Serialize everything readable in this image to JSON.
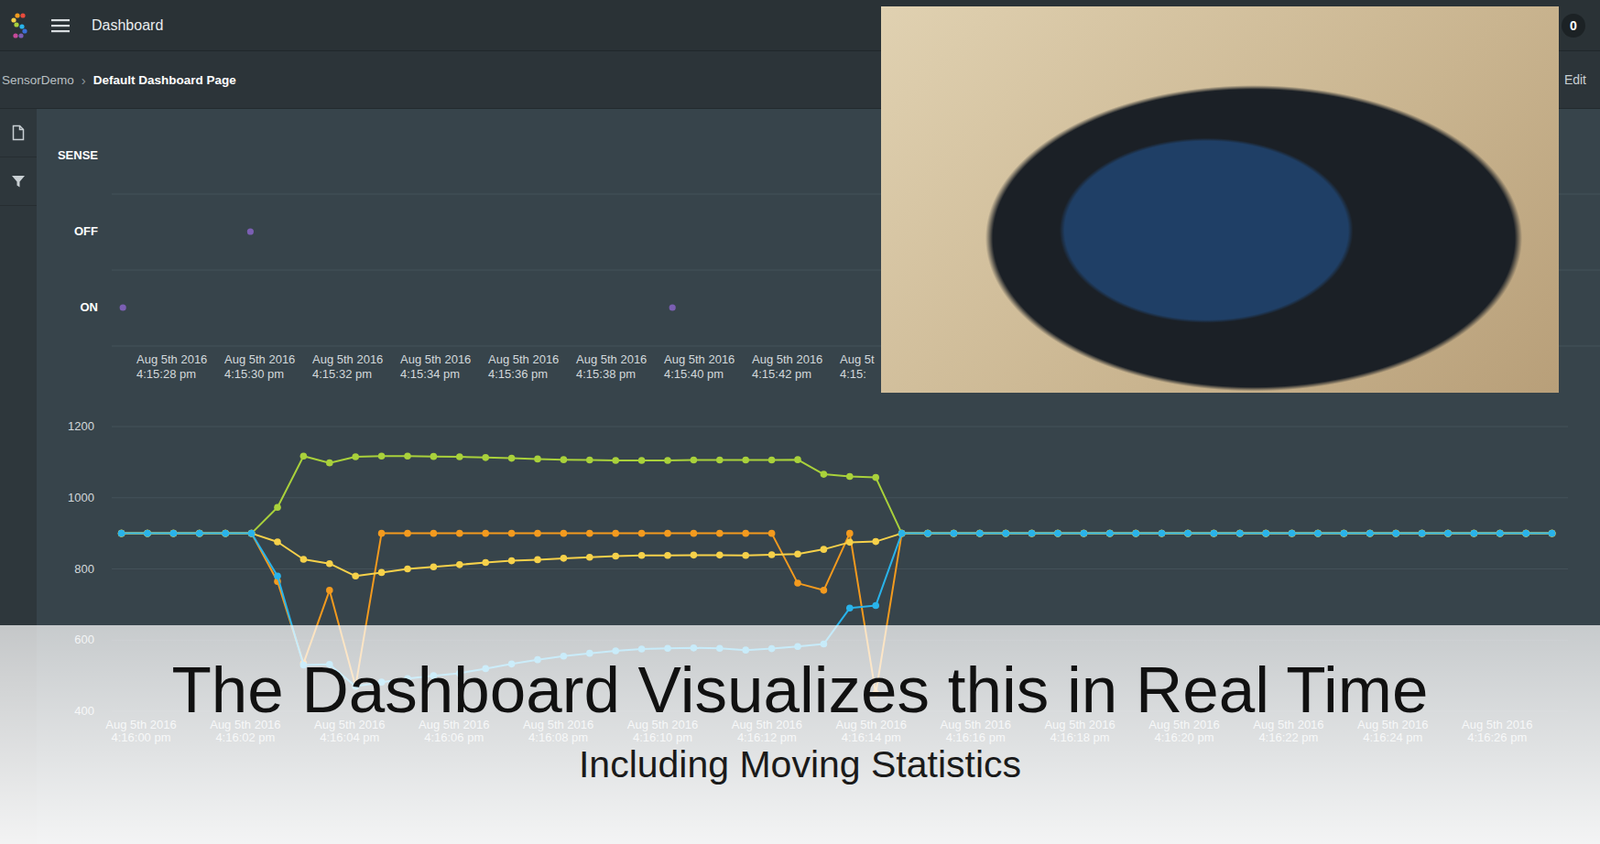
{
  "header": {
    "title": "Dashboard",
    "badge": "0"
  },
  "breadcrumb": {
    "items": [
      {
        "label": "SensorDemo",
        "current": false
      },
      {
        "label": "Default Dashboard Page",
        "current": true
      }
    ],
    "separator": "›",
    "action": "Edit"
  },
  "state_chart": {
    "categories": [
      "SENSE",
      "OFF",
      "ON"
    ],
    "ticks": [
      {
        "date": "Aug 5th 2016",
        "time": "4:15:28 pm"
      },
      {
        "date": "Aug 5th 2016",
        "time": "4:15:30 pm"
      },
      {
        "date": "Aug 5th 2016",
        "time": "4:15:32 pm"
      },
      {
        "date": "Aug 5th 2016",
        "time": "4:15:34 pm"
      },
      {
        "date": "Aug 5th 2016",
        "time": "4:15:36 pm"
      },
      {
        "date": "Aug 5th 2016",
        "time": "4:15:38 pm"
      },
      {
        "date": "Aug 5th 2016",
        "time": "4:15:40 pm"
      },
      {
        "date": "Aug 5th 2016",
        "time": "4:15:42 pm"
      },
      {
        "date": "Aug 5t",
        "time": "4:15:"
      }
    ],
    "points": [
      {
        "seconds_from_first_tick": -1.1,
        "state": "ON"
      },
      {
        "seconds_from_first_tick": 1.8,
        "state": "OFF"
      },
      {
        "seconds_from_first_tick": 11.4,
        "state": "ON"
      }
    ]
  },
  "value_chart": {
    "y_ticks": [
      "1200",
      "1000",
      "800",
      "600",
      "400"
    ],
    "x_ticks": [
      {
        "date": "Aug 5th 2016",
        "time": "4:16:00 pm"
      },
      {
        "date": "Aug 5th 2016",
        "time": "4:16:02 pm"
      },
      {
        "date": "Aug 5th 2016",
        "time": "4:16:04 pm"
      },
      {
        "date": "Aug 5th 2016",
        "time": "4:16:06 pm"
      },
      {
        "date": "Aug 5th 2016",
        "time": "4:16:08 pm"
      },
      {
        "date": "Aug 5th 2016",
        "time": "4:16:10 pm"
      },
      {
        "date": "Aug 5th 2016",
        "time": "4:16:12 pm"
      },
      {
        "date": "Aug 5th 2016",
        "time": "4:16:14 pm"
      },
      {
        "date": "Aug 5th 2016",
        "time": "4:16:16 pm"
      },
      {
        "date": "Aug 5th 2016",
        "time": "4:16:18 pm"
      },
      {
        "date": "Aug 5th 2016",
        "time": "4:16:20 pm"
      },
      {
        "date": "Aug 5th 2016",
        "time": "4:16:22 pm"
      },
      {
        "date": "Aug 5th 2016",
        "time": "4:16:24 pm"
      },
      {
        "date": "Aug 5th 2016",
        "time": "4:16:26 pm"
      }
    ],
    "series": [
      {
        "color": "#a9d13b",
        "values": [
          900,
          900,
          900,
          900,
          900,
          900,
          973,
          1117,
          1098,
          1115,
          1117,
          1117,
          1116,
          1115,
          1113,
          1111,
          1109,
          1107,
          1106,
          1105,
          1105,
          1105,
          1106,
          1106,
          1106,
          1106,
          1107,
          1066,
          1060,
          1057,
          900,
          900,
          900,
          900,
          900,
          900,
          900,
          900,
          900,
          900,
          900,
          900,
          900,
          900,
          900,
          900,
          900,
          900,
          900,
          900,
          900,
          900,
          900,
          900,
          900,
          900
        ]
      },
      {
        "color": "#f39a1e",
        "values": [
          900,
          900,
          900,
          900,
          900,
          900,
          765,
          535,
          740,
          470,
          900,
          900,
          900,
          900,
          900,
          900,
          900,
          900,
          900,
          900,
          900,
          900,
          900,
          900,
          900,
          900,
          760,
          740,
          900,
          450,
          900,
          900,
          900,
          900,
          900,
          900,
          900,
          900,
          900,
          900,
          900,
          900,
          900,
          900,
          900,
          900,
          900,
          900,
          900,
          900,
          900,
          900,
          900,
          900,
          900,
          900
        ]
      },
      {
        "color": "#f6d14a",
        "values": [
          900,
          900,
          900,
          900,
          900,
          900,
          876,
          827,
          815,
          780,
          790,
          800,
          806,
          812,
          818,
          823,
          826,
          830,
          833,
          836,
          838,
          838,
          839,
          839,
          838,
          840,
          842,
          855,
          875,
          877,
          900,
          900,
          900,
          900,
          900,
          900,
          900,
          900,
          900,
          900,
          900,
          900,
          900,
          900,
          900,
          900,
          900,
          900,
          900,
          900,
          900,
          900,
          900,
          900,
          900,
          900
        ]
      },
      {
        "color": "#29b3ea",
        "values": [
          900,
          900,
          900,
          900,
          900,
          900,
          780,
          530,
          532,
          470,
          482,
          492,
          500,
          507,
          520,
          533,
          545,
          555,
          563,
          570,
          575,
          577,
          578,
          577,
          572,
          576,
          582,
          589,
          690,
          697,
          900,
          900,
          900,
          900,
          900,
          900,
          900,
          900,
          900,
          900,
          900,
          900,
          900,
          900,
          900,
          900,
          900,
          900,
          900,
          900,
          900,
          900,
          900,
          900,
          900,
          900
        ]
      }
    ]
  },
  "caption": {
    "title": "The Dashboard Visualizes this in Real Time",
    "subtitle": "Including Moving Statistics"
  }
}
